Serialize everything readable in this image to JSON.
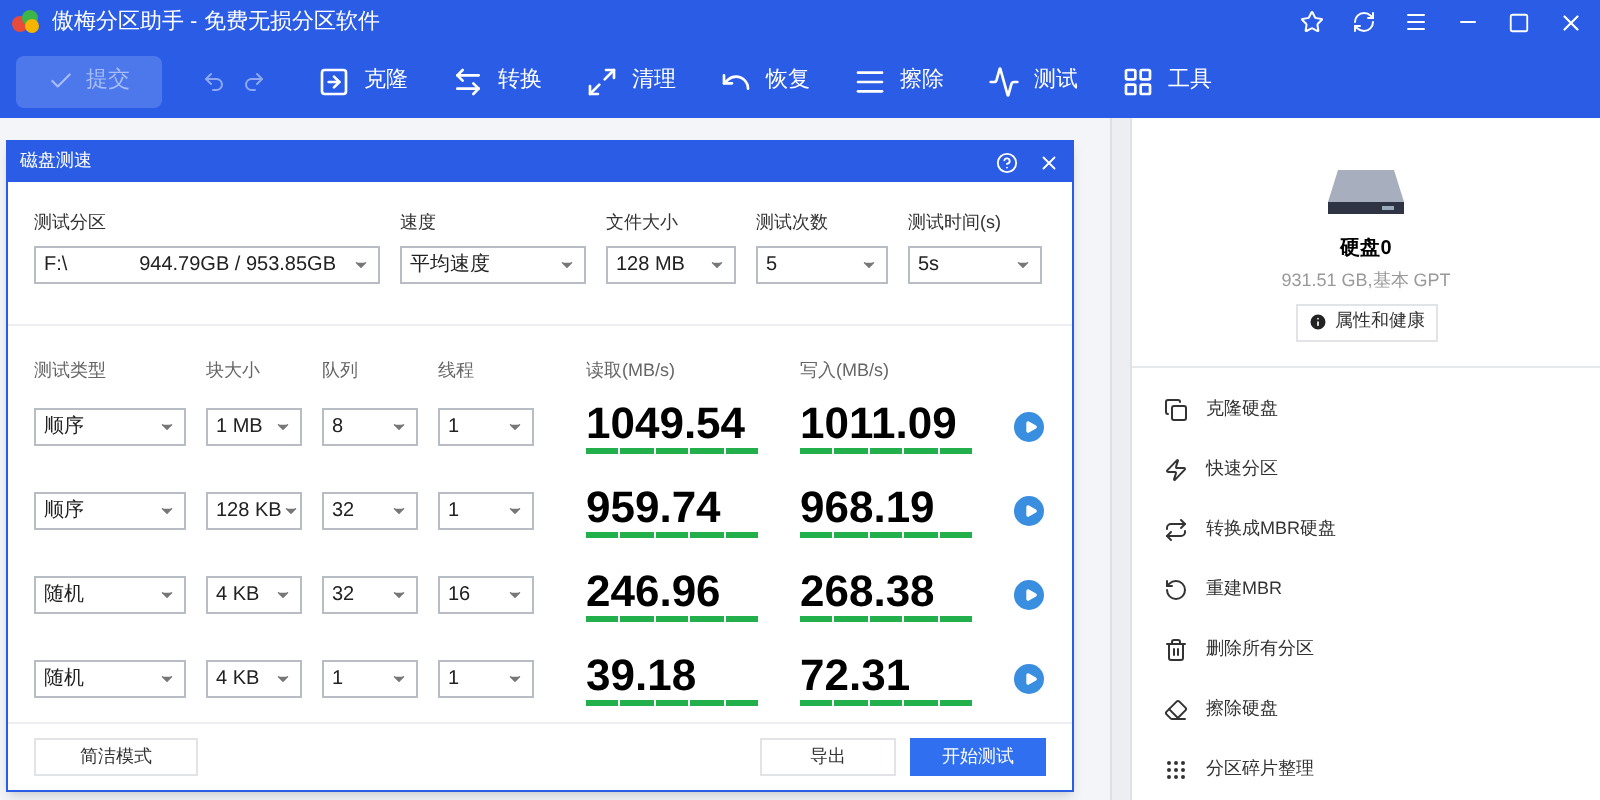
{
  "window": {
    "title": "傲梅分区助手 - 免费无损分区软件"
  },
  "toolbar": {
    "submit": {
      "label": "提交",
      "disabled": true
    },
    "tools": [
      {
        "label": "克隆",
        "kind": "clone"
      },
      {
        "label": "转换",
        "kind": "convert"
      },
      {
        "label": "清理",
        "kind": "clean"
      },
      {
        "label": "恢复",
        "kind": "recover"
      },
      {
        "label": "擦除",
        "kind": "wipe"
      },
      {
        "label": "测试",
        "kind": "test"
      },
      {
        "label": "工具",
        "kind": "tools"
      }
    ]
  },
  "dialog": {
    "title": "磁盘测速",
    "settings": [
      {
        "label": "测试分区",
        "value": "F:\\",
        "extra": "944.79GB / 953.85GB"
      },
      {
        "label": "速度",
        "value": "平均速度"
      },
      {
        "label": "文件大小",
        "value": "128 MB"
      },
      {
        "label": "测试次数",
        "value": "5"
      },
      {
        "label": "测试时间(s)",
        "value": "5s"
      }
    ],
    "columns": [
      "测试类型",
      "块大小",
      "队列",
      "线程",
      "读取(MB/s)",
      "写入(MB/s)"
    ],
    "rows": [
      {
        "type": "顺序",
        "block": "1 MB",
        "queue": "8",
        "thread": "1",
        "read": "1049.54",
        "write": "1011.09"
      },
      {
        "type": "顺序",
        "block": "128 KB",
        "queue": "32",
        "thread": "1",
        "read": "959.74",
        "write": "968.19"
      },
      {
        "type": "随机",
        "block": "4 KB",
        "queue": "32",
        "thread": "16",
        "read": "246.96",
        "write": "268.38"
      },
      {
        "type": "随机",
        "block": "4 KB",
        "queue": "1",
        "thread": "1",
        "read": "39.18",
        "write": "72.31"
      }
    ],
    "buttons": [
      {
        "label": "简洁模式",
        "kind": "secondary"
      },
      {
        "label": "导出",
        "kind": "secondary"
      },
      {
        "label": "开始测试",
        "kind": "primary"
      }
    ]
  },
  "disk_panel": {
    "name": "硬盘0",
    "info": "931.51 GB,基本 GPT",
    "button": "属性和健康",
    "actions": [
      {
        "label": "克隆硬盘",
        "kind": "clone"
      },
      {
        "label": "快速分区",
        "kind": "quick"
      },
      {
        "label": "转换成MBR硬盘",
        "kind": "convert"
      },
      {
        "label": "重建MBR",
        "kind": "rebuild"
      },
      {
        "label": "删除所有分区",
        "kind": "delete"
      },
      {
        "label": "擦除硬盘",
        "kind": "wipe"
      },
      {
        "label": "分区碎片整理",
        "kind": "defrag"
      }
    ]
  }
}
